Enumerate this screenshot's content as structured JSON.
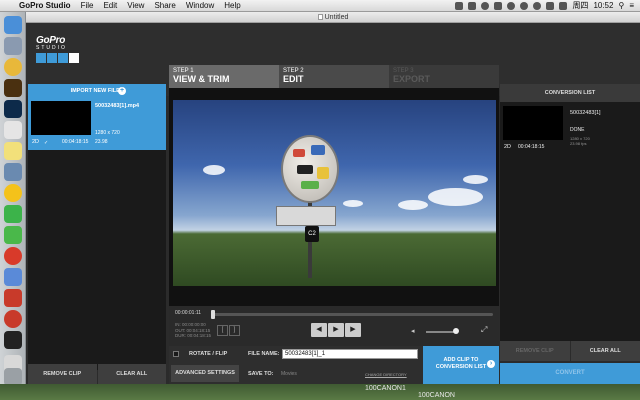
{
  "menubar": {
    "app_name": "GoPro Studio",
    "items": [
      "File",
      "Edit",
      "View",
      "Share",
      "Window",
      "Help"
    ],
    "clock": "10:52",
    "day": "周四"
  },
  "window": {
    "title": "Untitled"
  },
  "logo": {
    "brand": "GoPro",
    "sub": "STUDIO"
  },
  "steps": [
    {
      "num": "STEP 1",
      "name": "VIEW & TRIM"
    },
    {
      "num": "STEP 2",
      "name": "EDIT"
    },
    {
      "num": "STEP 3",
      "name": "EXPORT"
    }
  ],
  "left_panel": {
    "import_label": "IMPORT NEW FILES",
    "file": {
      "name": "50032483[1].mp4",
      "resolution": "1280 x 720",
      "fps": "23.98",
      "mode": "2D",
      "duration": "00:04:18:15"
    },
    "remove_label": "REMOVE CLIP",
    "clear_label": "CLEAR ALL"
  },
  "player": {
    "current_time": "00:00:01:11",
    "in_label": "IN:",
    "in_time": "00:00:00:00",
    "out_label": "OUT:",
    "out_time": "00:04:18:15",
    "dur_label": "DUR:",
    "dur_time": "00:04:18:15",
    "sign_text": "C2"
  },
  "settings": {
    "rotate_label": "ROTATE / FLIP",
    "advanced_label": "ADVANCED SETTINGS",
    "file_name_label": "FILE NAME:",
    "file_name_value": "50032483[1]_1",
    "save_to_label": "SAVE TO:",
    "save_to_value": "Movies",
    "change_dir_label": "CHANGE DIRECTORY"
  },
  "add_clip": {
    "line1": "ADD CLIP TO",
    "line2": "CONVERSION LIST"
  },
  "right_panel": {
    "header": "CONVERSION LIST",
    "item": {
      "name": "50032483[1]",
      "status": "DONE",
      "meta1": "1280 x 720",
      "meta2": "23.98 fps",
      "mode": "2D",
      "duration": "00:04:18:15"
    },
    "remove_label": "REMOVE CLIP",
    "clear_label": "CLEAR ALL",
    "convert_label": "CONVERT"
  },
  "desktop": {
    "label1": "100CANON1",
    "label2": "100CANON"
  },
  "colors": {
    "accent": "#3f9bd8",
    "panel": "#1a1a1a",
    "chrome": "#2e2e2e"
  }
}
